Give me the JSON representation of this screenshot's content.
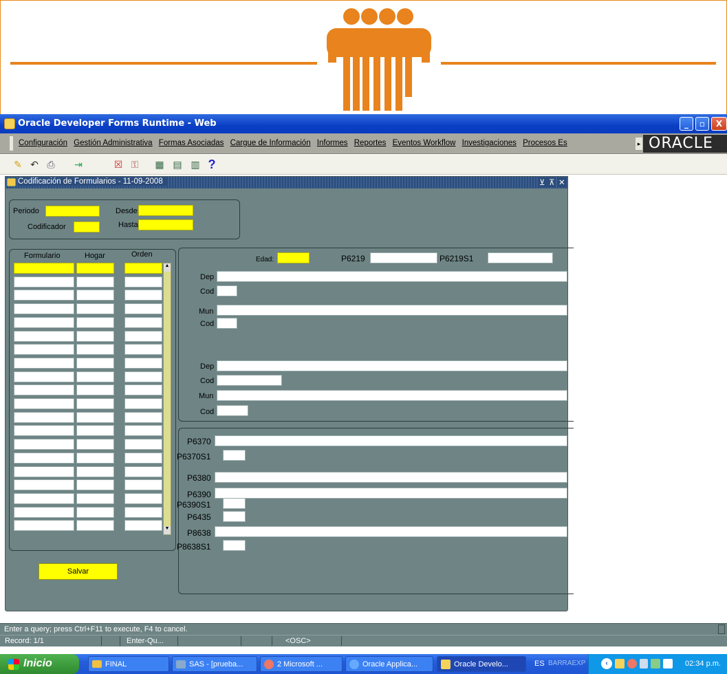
{
  "window": {
    "title": "Oracle Developer Forms Runtime - Web",
    "min": "_",
    "max": "▫",
    "close": "X"
  },
  "menu": {
    "items": [
      "Configuración",
      "Gestión Administrativa",
      "Formas Asociadas",
      "Cargue de Información",
      "Informes",
      "Reportes",
      "Eventos Workflow",
      "Investigaciones",
      "Procesos Es"
    ],
    "overflow": "▸",
    "logo": "ORACLE"
  },
  "toolbar": {
    "help": "?"
  },
  "form": {
    "title": "Codificación de Formularios - 11-09-2008",
    "controls": [
      "⊻",
      "⊼",
      "✕"
    ],
    "header": {
      "periodo": "Periodo",
      "codificador": "Codificador",
      "desde": "Desde",
      "hasta": "Hasta"
    },
    "grid": {
      "col_formulario": "Formulario",
      "col_hogar": "Hogar",
      "col_orden": "Orden"
    },
    "detail": {
      "edad": "Edad:",
      "p6219": "P6219",
      "p6219s1": "P6219S1",
      "dep1": "Dep",
      "cod1": "Cod",
      "mun1": "Mun",
      "cod2": "Cod",
      "dep2": "Dep",
      "cod3": "Cod",
      "mun2": "Mun",
      "cod4": "Cod"
    },
    "section2": {
      "p6370": "P6370",
      "p6370s1": "P6370S1",
      "p6380": "P6380",
      "p6390": "P6390",
      "p6390s1": "P6390S1",
      "p6435": "P6435",
      "p8638": "P8638",
      "p8638s1": "P8638S1"
    },
    "save_button": "Salvar"
  },
  "status": {
    "message": "Enter a query;  press Ctrl+F11 to execute, F4 to cancel.",
    "record": "Record: 1/1",
    "mode": "Enter-Qu...",
    "osc": "<OSC>"
  },
  "taskbar": {
    "start": "Inicio",
    "tasks": [
      "FINAL",
      "SAS - [prueba...",
      "2 Microsoft ...",
      "Oracle Applica...",
      "Oracle Develo..."
    ],
    "lang": "ES",
    "toolbar_name": "BARRAEXP",
    "clock": "02:34 p.m."
  }
}
